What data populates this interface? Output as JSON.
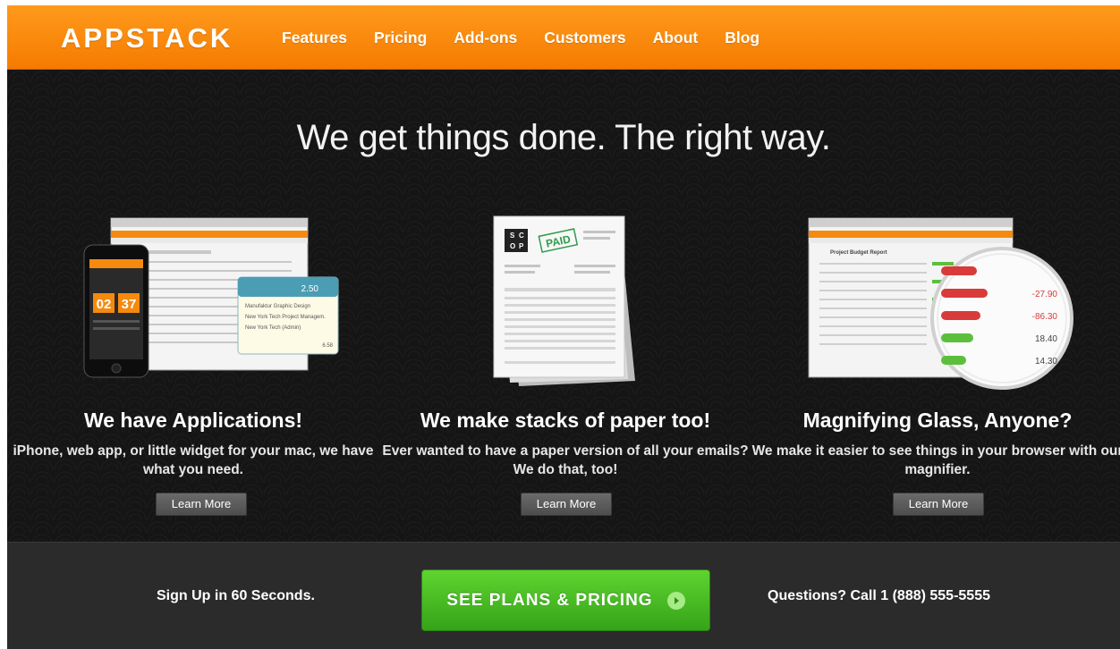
{
  "brand": {
    "logo": "APPSTACK",
    "accent": "#f98a0b",
    "cta_color": "#48bb22"
  },
  "nav": [
    "Features",
    "Pricing",
    "Add-ons",
    "Customers",
    "About",
    "Blog"
  ],
  "hero": {
    "title": "We get things done. The right way.",
    "features": [
      {
        "title": "We have Applications!",
        "text": "iPhone, web app, or little widget for your mac, we have what you need.",
        "button": "Learn More",
        "phone": {
          "hours": "02",
          "minutes": "37"
        },
        "widget": {
          "value": "2.50",
          "items": [
            "Manufaktur Graphic Design",
            "New York Tech Project Managem.",
            "New York Tech (Admin)"
          ],
          "total": "6.58"
        }
      },
      {
        "title": "We make stacks of paper too!",
        "text": "Ever wanted to have a paper version of all your emails? We do that, too!",
        "button": "Learn More",
        "stamp": "PAID",
        "paper_logo": [
          "S",
          "C",
          "O",
          "P"
        ]
      },
      {
        "title": "Magnifying Glass, Anyone?",
        "text": "We make it easier to see things in your browser with our magnifier.",
        "button": "Learn More",
        "magnifier_values": [
          "-27.90",
          "-86.30",
          "18.40",
          "14.30"
        ],
        "report_title": "Project Budget Report"
      }
    ]
  },
  "footer": {
    "signup": "Sign Up in 60 Seconds.",
    "cta": "SEE PLANS & PRICING",
    "questions": "Questions? Call 1 (888) 555-5555"
  }
}
